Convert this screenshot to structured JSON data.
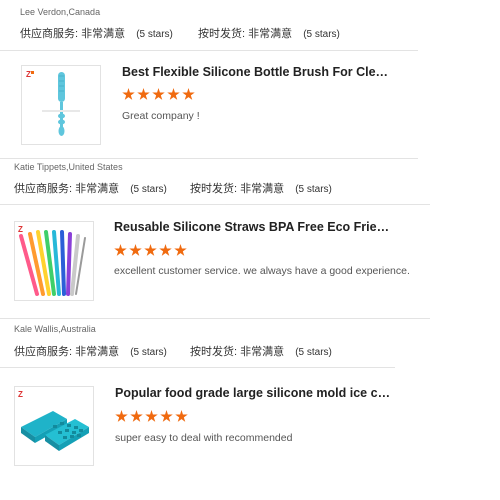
{
  "labels": {
    "supplier_service": "供应商服务:",
    "on_time_shipping": "按时发货:",
    "very_satisfied": "非常满意",
    "five_stars": "(5 stars)"
  },
  "colors": {
    "star": "#f06a0f",
    "divider": "#e3e3e3"
  },
  "reviews": [
    {
      "reviewer": "Lee Verdon,Canada",
      "product": "Best Flexible Silicone Bottle Brush For Cleaning..",
      "rating": 5,
      "comment": "Great company !",
      "thumb_icon": "bottle-brush-image"
    },
    {
      "reviewer": "Katie Tippets,United States",
      "product": "Reusable Silicone Straws BPA Free Eco Friendly..",
      "rating": 5,
      "comment": "excellent customer service. we always have a good experience.",
      "thumb_icon": "silicone-straws-image"
    },
    {
      "reviewer": "Kale Wallis,Australia",
      "product": "Popular food grade large silicone mold ice cub...",
      "rating": 5,
      "comment": "super easy to deal with recommended",
      "thumb_icon": "ice-cube-mold-image"
    }
  ]
}
